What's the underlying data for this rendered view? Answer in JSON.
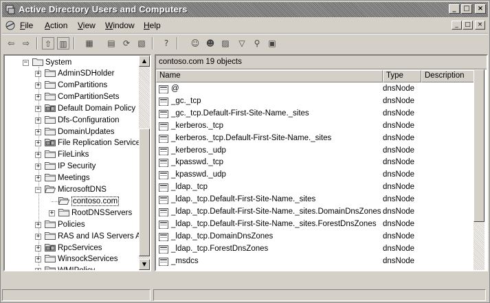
{
  "window": {
    "title": "Active Directory Users and Computers",
    "caption_buttons": [
      "_",
      "□",
      "×"
    ]
  },
  "menubar": {
    "items": [
      {
        "label": "File",
        "accel": "F",
        "rest": "ile"
      },
      {
        "label": "Action",
        "accel": "A",
        "rest": "ction"
      },
      {
        "label": "View",
        "accel": "V",
        "rest": "iew"
      },
      {
        "label": "Window",
        "accel": "W",
        "rest": "indow"
      },
      {
        "label": "Help",
        "accel": "H",
        "rest": "elp"
      }
    ],
    "mdi_buttons": [
      "_",
      "□",
      "×"
    ]
  },
  "toolbar": {
    "icons": [
      "back-arrow-icon",
      "forward-arrow-icon",
      "up-level-icon",
      "show-tree-icon",
      "delete-icon",
      "properties-icon",
      "refresh-icon",
      "export-list-icon",
      "help-icon",
      "add-user-icon",
      "add-group-icon",
      "add-ou-icon",
      "filter-icon",
      "find-icon",
      "add-to-group-icon"
    ],
    "glyphs": [
      "⇦",
      "⇨",
      "⇧",
      "▥",
      "▦",
      "▤",
      "⟳",
      "▧",
      "?",
      "☺",
      "☻",
      "▨",
      "▽",
      "⚲",
      "▣"
    ]
  },
  "tree": {
    "root": {
      "label": "System",
      "expanded": true
    },
    "items": [
      {
        "label": "AdminSDHolder",
        "expander": "+"
      },
      {
        "label": "ComPartitions",
        "expander": "+"
      },
      {
        "label": "ComPartitionSets",
        "expander": "+"
      },
      {
        "label": "Default Domain Policy",
        "expander": "+",
        "icon": "policy"
      },
      {
        "label": "Dfs-Configuration",
        "expander": "+"
      },
      {
        "label": "DomainUpdates",
        "expander": "+"
      },
      {
        "label": "File Replication Service",
        "expander": "+",
        "icon": "policy"
      },
      {
        "label": "FileLinks",
        "expander": "+"
      },
      {
        "label": "IP Security",
        "expander": "+"
      },
      {
        "label": "Meetings",
        "expander": "+"
      },
      {
        "label": "MicrosoftDNS",
        "expander": "−",
        "open": true
      },
      {
        "label": "contoso.com",
        "child": true,
        "selected": true
      },
      {
        "label": "RootDNSServers",
        "child": true,
        "expander": "+"
      },
      {
        "label": "Policies",
        "expander": "+"
      },
      {
        "label": "RAS and IAS Servers Access Check",
        "expander": "+"
      },
      {
        "label": "RpcServices",
        "expander": "+",
        "icon": "policy"
      },
      {
        "label": "WinsockServices",
        "expander": "+"
      },
      {
        "label": "WMIPolicy",
        "expander": "+"
      }
    ]
  },
  "details": {
    "header": "contoso.com   19 objects",
    "columns": [
      "Name",
      "Type",
      "Description"
    ],
    "rows": [
      {
        "name": "@",
        "type": "dnsNode"
      },
      {
        "name": "_gc._tcp",
        "type": "dnsNode"
      },
      {
        "name": "_gc._tcp.Default-First-Site-Name._sites",
        "type": "dnsNode"
      },
      {
        "name": "_kerberos._tcp",
        "type": "dnsNode"
      },
      {
        "name": "_kerberos._tcp.Default-First-Site-Name._sites",
        "type": "dnsNode"
      },
      {
        "name": "_kerberos._udp",
        "type": "dnsNode"
      },
      {
        "name": "_kpasswd._tcp",
        "type": "dnsNode"
      },
      {
        "name": "_kpasswd._udp",
        "type": "dnsNode"
      },
      {
        "name": "_ldap._tcp",
        "type": "dnsNode"
      },
      {
        "name": "_ldap._tcp.Default-First-Site-Name._sites",
        "type": "dnsNode"
      },
      {
        "name": "_ldap._tcp.Default-First-Site-Name._sites.DomainDnsZones",
        "type": "dnsNode"
      },
      {
        "name": "_ldap._tcp.Default-First-Site-Name._sites.ForestDnsZones",
        "type": "dnsNode"
      },
      {
        "name": "_ldap._tcp.DomainDnsZones",
        "type": "dnsNode"
      },
      {
        "name": "_ldap._tcp.ForestDnsZones",
        "type": "dnsNode"
      },
      {
        "name": "_msdcs",
        "type": "dnsNode"
      }
    ]
  },
  "scroll_arrows": {
    "up": "▲",
    "down": "▼"
  }
}
